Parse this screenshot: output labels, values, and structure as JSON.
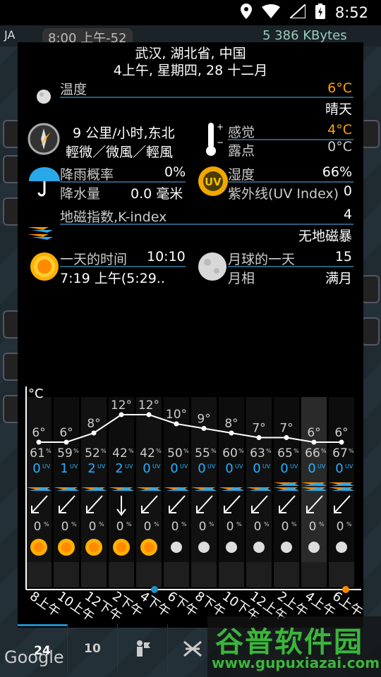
{
  "status": {
    "time": "8:52"
  },
  "background": {
    "ja": "JA",
    "time_pill": "8:00 上午-52",
    "bytes": "5 386 KBytes",
    "google": "Google"
  },
  "header": {
    "line1": "武汉, 湖北省, 中国",
    "line2": "4上午, 星期四, 28 十二月"
  },
  "temperature": {
    "label": "温度",
    "value": "6°C",
    "condition": "晴天"
  },
  "wind": {
    "speed": "9 公里/小时,东北",
    "desc": "輕微／微風／輕風"
  },
  "feel": {
    "label": "感觉",
    "value": "4°C",
    "dew_label": "露点",
    "dew_value": "0°C"
  },
  "rain": {
    "prob_label": "降雨概率",
    "prob_value": "0%",
    "amount_label": "降水量",
    "amount_value": "0.0 毫米"
  },
  "humidity": {
    "label": "湿度",
    "value": "66%",
    "uv_label": "紫外线(UV Index)",
    "uv_value": "0"
  },
  "kindex": {
    "label": "地磁指数,K-index",
    "value": "4",
    "desc": "无地磁暴"
  },
  "day": {
    "label": "一天的时间",
    "value": "10:10",
    "sunrise": "7:19 上午(5:29.."
  },
  "moon": {
    "label": "月球的一天",
    "value": "15",
    "phase_label": "月相",
    "phase_value": "满月"
  },
  "chart_data": {
    "type": "line",
    "ylabel": "°C",
    "x": [
      "8上午",
      "10上午",
      "12下午",
      "2下午",
      "4下午",
      "6下午",
      "8下午",
      "10下午",
      "12上午",
      "2上午",
      "4上午",
      "6上午"
    ],
    "series": [
      {
        "values": [
          6,
          6,
          8,
          12,
          12,
          10,
          9,
          8,
          7,
          7,
          6,
          6
        ]
      }
    ],
    "temps_labels": [
      "6°",
      "6°",
      "8°",
      "12°",
      "12°",
      "10°",
      "9°",
      "8°",
      "7°",
      "7°",
      "6°",
      "6°"
    ],
    "humidity": [
      "61",
      "59",
      "52",
      "42",
      "42",
      "50",
      "55",
      "60",
      "63",
      "65",
      "66",
      "67"
    ],
    "uv": [
      "0",
      "1",
      "2",
      "2",
      "0",
      "0",
      "0",
      "0",
      "0",
      "0",
      "0",
      "0"
    ],
    "precip": [
      "0",
      "0",
      "0",
      "0",
      "0",
      "0",
      "0",
      "0",
      "0",
      "0",
      "0",
      "0"
    ],
    "icons": [
      "sun",
      "sun",
      "sun",
      "sun",
      "sun",
      "moon",
      "moon",
      "moon",
      "moon",
      "moon",
      "moon",
      "moon"
    ],
    "highlight_index": 10
  },
  "tabs": {
    "t24": "24",
    "t10": "10"
  },
  "watermark": {
    "brand": "谷普软件园",
    "url": "www.gupuxiazai.com"
  },
  "colors": {
    "accent": "#1e8fc8",
    "orange": "#ffa200",
    "rule": "#2b5d7a",
    "uv": "#29b0ff"
  }
}
